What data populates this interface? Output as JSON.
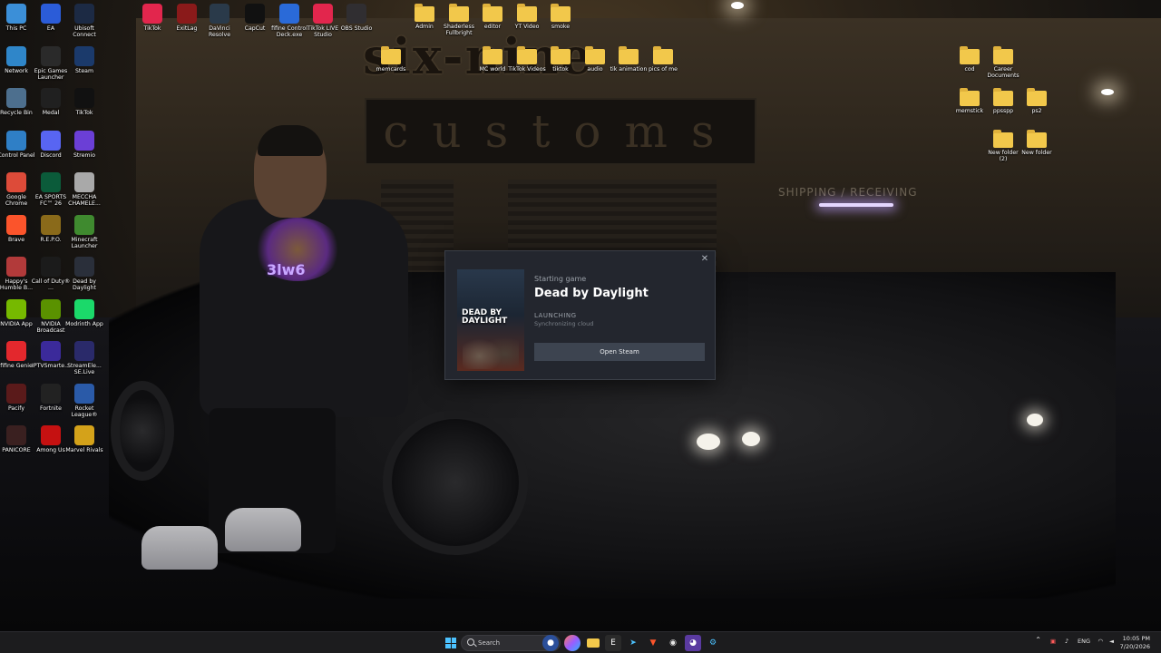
{
  "desktop": {
    "icons_left": [
      {
        "label": "This PC",
        "icon": "this-pc-icon",
        "color": "#3b8fd8"
      },
      {
        "label": "EA",
        "icon": "ea-icon",
        "color": "#2b5cd8"
      },
      {
        "label": "Ubisoft Connect",
        "icon": "ubisoft-icon",
        "color": "#1c2a44"
      },
      {
        "label": "Network",
        "icon": "network-icon",
        "color": "#2f86c9"
      },
      {
        "label": "Epic Games Launcher",
        "icon": "epic-games-icon",
        "color": "#2a2a2a"
      },
      {
        "label": "Steam",
        "icon": "steam-icon",
        "color": "#1b3a6b"
      },
      {
        "label": "Recycle Bin",
        "icon": "recycle-bin-icon",
        "color": "#4d6f8e"
      },
      {
        "label": "Medal",
        "icon": "medal-icon",
        "color": "#202020"
      },
      {
        "label": "TikTok",
        "icon": "tiktok-icon",
        "color": "#111111"
      },
      {
        "label": "Control Panel",
        "icon": "control-panel-icon",
        "color": "#2f7fc6"
      },
      {
        "label": "Discord",
        "icon": "discord-icon",
        "color": "#5865f2"
      },
      {
        "label": "Stremio",
        "icon": "stremio-icon",
        "color": "#6b3fd6"
      },
      {
        "label": "Google Chrome",
        "icon": "chrome-icon",
        "color": "#dd4b39"
      },
      {
        "label": "EA SPORTS FC™ 26",
        "icon": "ea-fc-icon",
        "color": "#0b5b3a"
      },
      {
        "label": "MECCHA CHAMELE...",
        "icon": "meccha-icon",
        "color": "#a9a9a9"
      },
      {
        "label": "Brave",
        "icon": "brave-icon",
        "color": "#fb542b"
      },
      {
        "label": "R.E.P.O.",
        "icon": "repo-icon",
        "color": "#8a6a1a"
      },
      {
        "label": "Minecraft Launcher",
        "icon": "minecraft-icon",
        "color": "#3f8a2f"
      },
      {
        "label": "Happy's Humble B...",
        "icon": "happys-icon",
        "color": "#b23a3a"
      },
      {
        "label": "Call of Duty® ...",
        "icon": "cod-icon",
        "color": "#1b1b1b"
      },
      {
        "label": "Dead by Daylight",
        "icon": "dbd-icon",
        "color": "#2a2f3a"
      },
      {
        "label": "NVIDIA App",
        "icon": "nvidia-icon",
        "color": "#76b900"
      },
      {
        "label": "NVIDIA Broadcast",
        "icon": "nvidia-broadcast-icon",
        "color": "#5a9200"
      },
      {
        "label": "Modrinth App",
        "icon": "modrinth-icon",
        "color": "#1bd96a"
      },
      {
        "label": "fifine Genie",
        "icon": "fifine-genie-icon",
        "color": "#e3282d"
      },
      {
        "label": "IPTVSmarte...",
        "icon": "iptv-icon",
        "color": "#3b2a9a"
      },
      {
        "label": "StreamEle... SE.Live",
        "icon": "streamelements-icon",
        "color": "#2a2a6a"
      },
      {
        "label": "Pacify",
        "icon": "pacify-icon",
        "color": "#5a1a1a"
      },
      {
        "label": "Fortnite",
        "icon": "fortnite-icon",
        "color": "#222222"
      },
      {
        "label": "Rocket League®",
        "icon": "rocket-league-icon",
        "color": "#2a5aa8"
      },
      {
        "label": "PANICORE",
        "icon": "panicore-icon",
        "color": "#3a2020"
      },
      {
        "label": "Among Us",
        "icon": "among-us-icon",
        "color": "#c51111"
      },
      {
        "label": "Marvel Rivals",
        "icon": "marvel-rivals-icon",
        "color": "#d4a21a"
      }
    ],
    "icons_top": [
      {
        "label": "TikTok",
        "icon": "tiktok-studio-icon",
        "color": "#e2264d"
      },
      {
        "label": "ExitLag",
        "icon": "exitlag-icon",
        "color": "#8a1a1a"
      },
      {
        "label": "DaVinci Resolve",
        "icon": "davinci-icon",
        "color": "#2a3a4a"
      },
      {
        "label": "CapCut",
        "icon": "capcut-icon",
        "color": "#111111"
      },
      {
        "label": "fifine Control Deck.exe",
        "icon": "fifine-deck-icon",
        "color": "#2a6ad8"
      },
      {
        "label": "TikTok LIVE Studio",
        "icon": "tiktok-live-icon",
        "color": "#e2264d"
      },
      {
        "label": "OBS Studio",
        "icon": "obs-icon",
        "color": "#302e31"
      }
    ],
    "folders_top": [
      {
        "label": "Admin"
      },
      {
        "label": "Shaderless Fullbright"
      },
      {
        "label": "editor"
      },
      {
        "label": "YT Video"
      },
      {
        "label": "smoke"
      }
    ],
    "folders_row2": [
      {
        "label": "memcards"
      },
      {
        "label": "MC world"
      },
      {
        "label": "TikTok Videos"
      },
      {
        "label": "tiktok"
      },
      {
        "label": "audio"
      },
      {
        "label": "tik animation"
      },
      {
        "label": "pics of me"
      }
    ],
    "folders_right": [
      {
        "label": "cod"
      },
      {
        "label": "Career Documents"
      },
      {
        "label": "memstick"
      },
      {
        "label": "ppsspp"
      },
      {
        "label": "ps2"
      },
      {
        "label": "New folder (2)"
      },
      {
        "label": "New folder"
      }
    ]
  },
  "wallpaper": {
    "sign_top": "six-nine",
    "sign_board": "customs",
    "shipping_text": "SHIPPING / RECEIVING",
    "hoodie_logo": "3lw6"
  },
  "steam_dialog": {
    "close_glyph": "✕",
    "status_label": "Starting game",
    "game_title": "Dead by Daylight",
    "cover_title": "DEAD BY DAYLIGHT",
    "launch_state": "LAUNCHING",
    "launch_detail": "Synchronizing cloud",
    "open_steam_label": "Open Steam"
  },
  "taskbar": {
    "search_placeholder": "Search",
    "language": "ENG",
    "time": "10:05 PM",
    "date": "7/20/2026"
  }
}
